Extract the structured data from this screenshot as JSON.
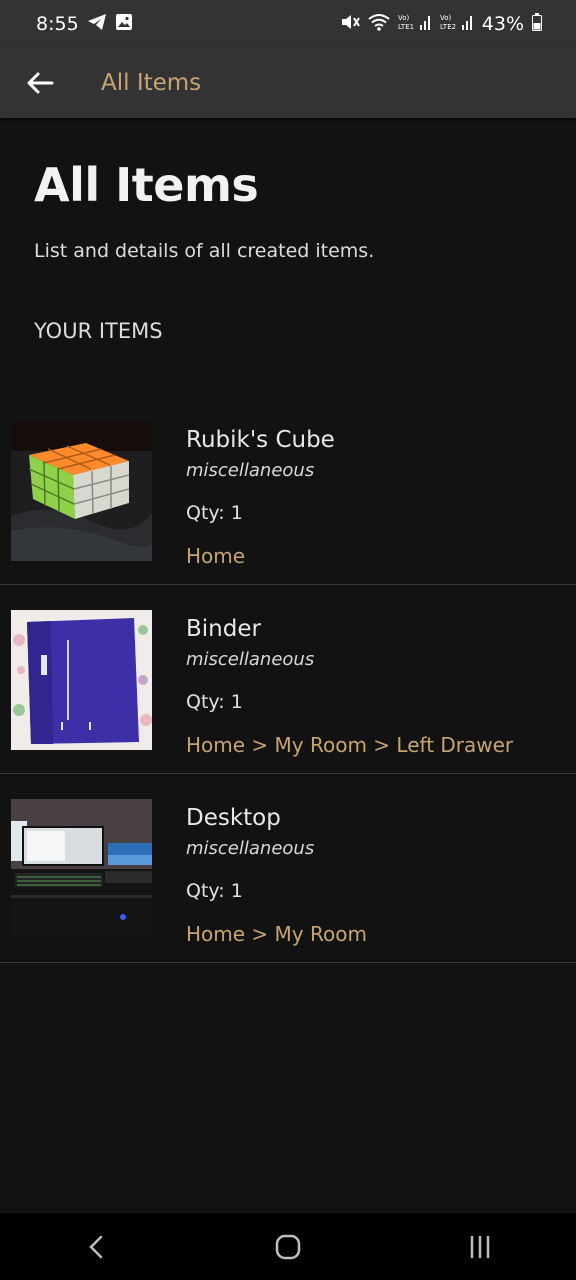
{
  "status_bar": {
    "time": "8:55",
    "left_icons": [
      "telegram-icon",
      "gallery-icon"
    ],
    "right_icons": [
      "mute-icon",
      "wifi-icon",
      "lte1-signal-icon",
      "lte2-signal-icon"
    ],
    "battery_percent": "43%"
  },
  "app_bar": {
    "title": "All Items"
  },
  "page": {
    "title": "All Items",
    "subtitle": "List and details of all created items.",
    "section_heading": "YOUR ITEMS"
  },
  "items": [
    {
      "name": "Rubik's Cube",
      "category": "miscellaneous",
      "qty": "Qty: 1",
      "location": "Home"
    },
    {
      "name": "Binder",
      "category": "miscellaneous",
      "qty": "Qty: 1",
      "location": "Home > My Room > Left Drawer"
    },
    {
      "name": "Desktop",
      "category": "miscellaneous",
      "qty": "Qty: 1",
      "location": "Home > My Room"
    }
  ],
  "nav_bar": {
    "icons": [
      "back-nav-icon",
      "home-nav-icon",
      "recents-nav-icon"
    ]
  },
  "colors": {
    "accent": "#c7a571",
    "background": "#121212",
    "bar": "#333333"
  }
}
